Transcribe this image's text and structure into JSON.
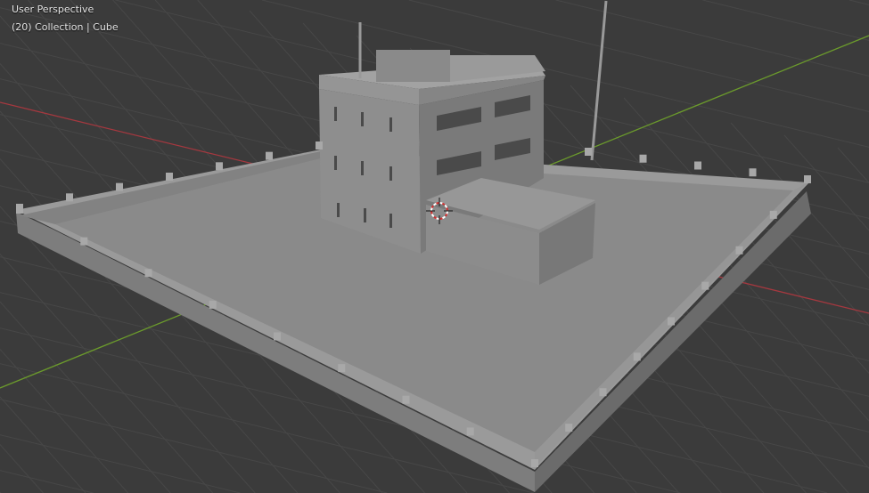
{
  "viewport": {
    "view_name": "User Perspective",
    "collection_info": "(20) Collection | Cube",
    "colors": {
      "background": "#3b3b3b",
      "grid": "#474747",
      "x_axis": "#a5383f",
      "y_axis": "#6b9a2c",
      "model": "#8c8c8c"
    }
  }
}
